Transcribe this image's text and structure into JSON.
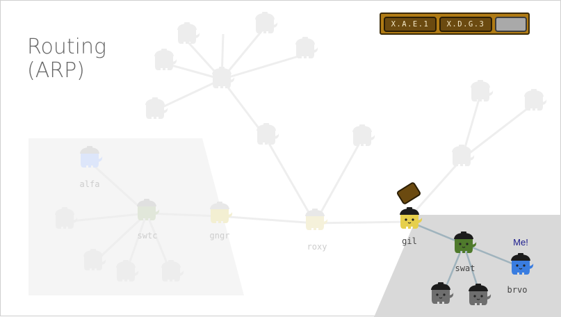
{
  "title": {
    "line1": "Routing",
    "line2": "(ARP)"
  },
  "address_bar": {
    "slots": [
      "X.A.E.1",
      "X.D.G.3",
      ""
    ]
  },
  "nodes": {
    "alfa": "alfa",
    "swtc": "swtc",
    "gngr": "gngr",
    "roxy": "roxy",
    "gil": "gil",
    "swat": "swat",
    "brvo": "brvo"
  },
  "me_label": "Me!",
  "colors": {
    "background": "#ffffff",
    "left_zone": "#f5f5f5",
    "right_zone": "#d9d9d9",
    "address_bar": "#b07b14",
    "address_slot": "#6b4a10",
    "empty_slot": "#a9a9a9",
    "gil": "#e6cf4c",
    "swat": "#4f7a2c",
    "brvo": "#3a7de0",
    "me_label": "#1a1a8c",
    "edge_faded": "#eeeeee",
    "edge_active": "#9fb3bd"
  }
}
